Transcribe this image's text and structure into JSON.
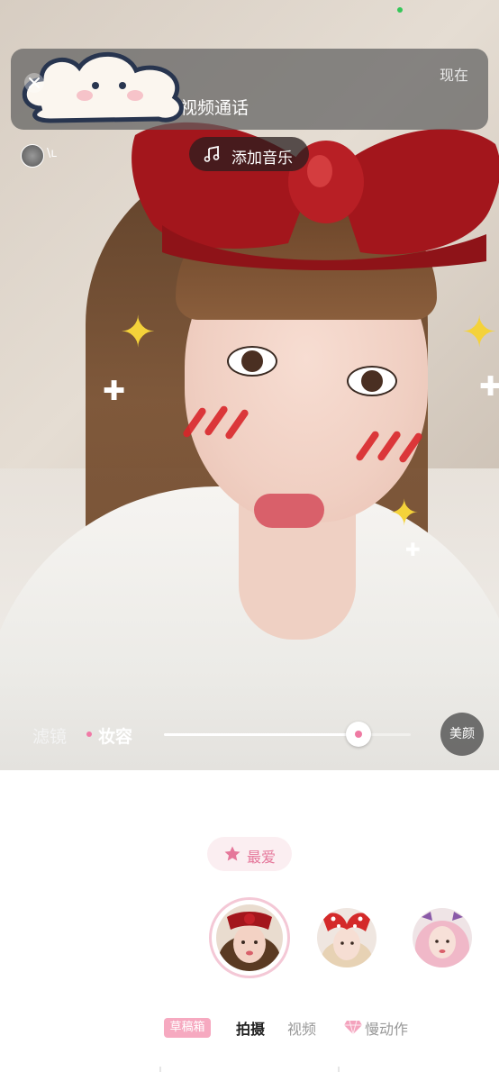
{
  "notification": {
    "text": "视频通话",
    "time": "现在"
  },
  "preview": {
    "add_music_label": "添加音乐",
    "user_label": "\\ʟ"
  },
  "adjust": {
    "filter_tab": "滤镜",
    "makeup_tab": "妆容",
    "slider_value": 0.79,
    "beauty_button": "美颜"
  },
  "favorites": {
    "label": "最爱"
  },
  "effects": [
    {
      "name": "red-bow-effect",
      "selected": true
    },
    {
      "name": "polka-bow-effect",
      "selected": false
    },
    {
      "name": "pink-hair-effect",
      "selected": false
    }
  ],
  "modes": {
    "draft_badge": "草稿箱",
    "shoot": "拍摄",
    "video": "视频",
    "slow_motion": "慢动作"
  },
  "colors": {
    "accent_pink": "#e5779a",
    "draft_badge_bg": "#f6a9c0",
    "bow_red": "#a3161c",
    "sparkle_yellow": "#f4d23a"
  }
}
